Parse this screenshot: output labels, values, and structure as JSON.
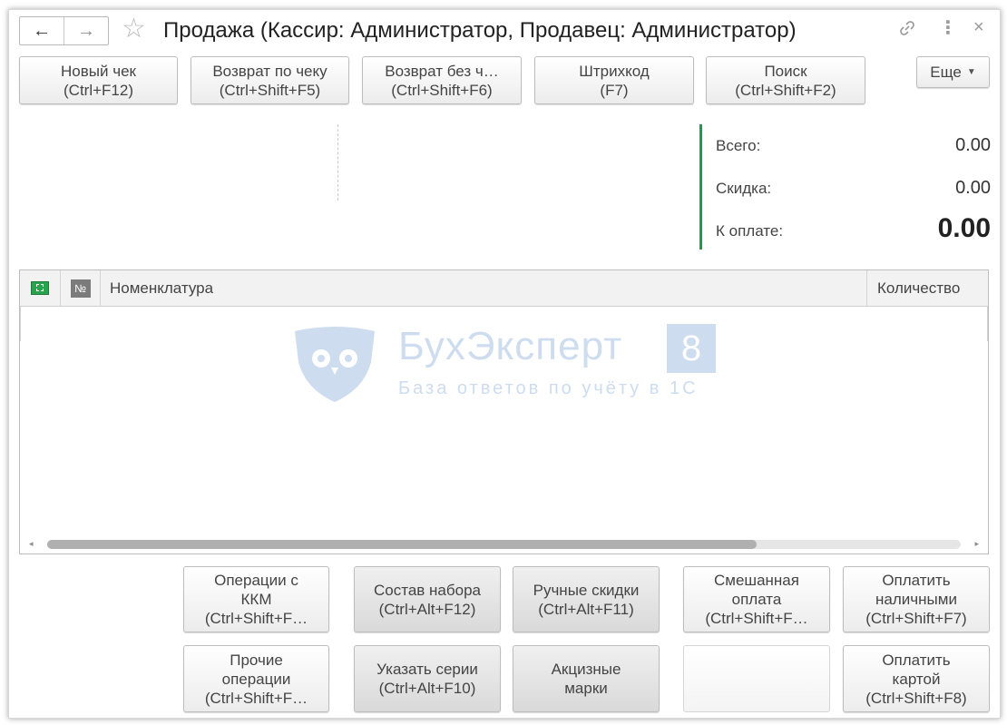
{
  "window": {
    "title": "Продажа (Кассир: Администратор, Продавец: Администратор)"
  },
  "icons": {
    "back": "←",
    "forward": "→",
    "star": "☆",
    "link": "🔗",
    "more_vertical": "⋮",
    "close": "×"
  },
  "toolbar": {
    "buttons": [
      {
        "line1": "Новый чек",
        "line2": "(Ctrl+F12)"
      },
      {
        "line1": "Возврат по чеку",
        "line2": "(Ctrl+Shift+F5)"
      },
      {
        "line1": "Возврат без ч…",
        "line2": "(Ctrl+Shift+F6)"
      },
      {
        "line1": "Штрихкод",
        "line2": "(F7)"
      },
      {
        "line1": "Поиск",
        "line2": "(Ctrl+Shift+F2)"
      }
    ],
    "more_label": "Еще"
  },
  "totals": {
    "total_label": "Всего:",
    "total_value": "0.00",
    "discount_label": "Скидка:",
    "discount_value": "0.00",
    "to_pay_label": "К оплате:",
    "to_pay_value": "0.00",
    "accent_color": "#1e9b4b"
  },
  "table": {
    "num_header": "№",
    "name_header": "Номенклатура",
    "qty_header": "Количество"
  },
  "watermark": {
    "brand": "БухЭксперт",
    "eight": "8",
    "subtitle": "База ответов по учёту в 1С"
  },
  "actions": {
    "row1": [
      {
        "line1": "Операции с",
        "line2": "ККМ",
        "line3": "(Ctrl+Shift+F…"
      },
      {
        "line1": "Состав набора",
        "line2": "(Ctrl+Alt+F12)"
      },
      {
        "line1": "Ручные скидки",
        "line2": "(Ctrl+Alt+F11)"
      },
      {
        "line1": "Смешанная",
        "line2": "оплата",
        "line3": "(Ctrl+Shift+F…"
      },
      {
        "line1": "Оплатить",
        "line2": "наличными",
        "line3": "(Ctrl+Shift+F7)"
      }
    ],
    "row2": [
      {
        "line1": "Прочие",
        "line2": "операции",
        "line3": "(Ctrl+Shift+F…"
      },
      {
        "line1": "Указать серии",
        "line2": "(Ctrl+Alt+F10)"
      },
      {
        "line1": "Акцизные",
        "line2": "марки"
      },
      {
        "line1": "Оплатить",
        "line2": "картой",
        "line3": "(Ctrl+Shift+F8)"
      }
    ]
  }
}
